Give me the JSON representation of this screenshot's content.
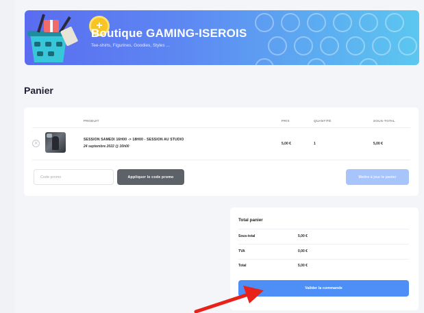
{
  "banner": {
    "title": "Boutique GAMING-ISEROIS",
    "subtitle": "Tee-shirts, Figurines, Goodies, Styles ..."
  },
  "page": {
    "heading": "Panier"
  },
  "cart": {
    "columns": {
      "product": "PRODUIT",
      "price": "PRIX",
      "quantity": "QUANTITÉ",
      "subtotal": "SOUS-TOTAL"
    },
    "item": {
      "name": "SESSION SAMEDI 16H00 -> 18H00 - SESSION AU STUDIO",
      "date": "24 septembre 2022 @ 16h00",
      "price": "5,00 €",
      "quantity": "1",
      "subtotal": "5,00 €"
    },
    "promo_placeholder": "Code promo",
    "apply_label": "Appliquer le code promo",
    "update_label": "Mettre à jour le panier"
  },
  "totals": {
    "title": "Total panier",
    "rows": [
      {
        "label": "Sous-total",
        "value": "5,00 €"
      },
      {
        "label": "TVA",
        "value": "0,00 €"
      },
      {
        "label": "Total",
        "value": "5,00 €"
      }
    ],
    "checkout_label": "Valider la commande"
  },
  "colors": {
    "accent": "#4d8ff7",
    "apply_button": "#5d6168",
    "update_button_disabled": "#a7c5fa",
    "annotation_arrow": "#e8211a"
  }
}
